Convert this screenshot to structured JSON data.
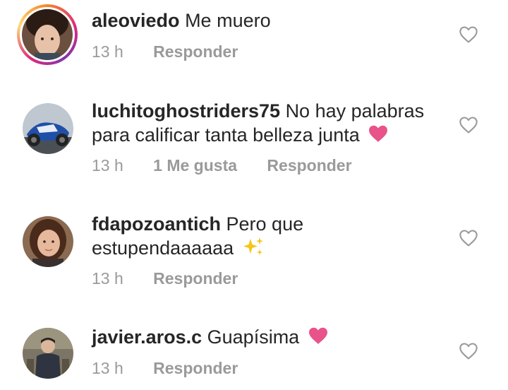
{
  "comments": [
    {
      "username": "aleoviedo",
      "text": "Me muero",
      "time": "13 h",
      "likes": "",
      "reply": "Responder",
      "has_story_ring": true,
      "emoji": ""
    },
    {
      "username": "luchitoghostriders75",
      "text": "No hay palabras para calificar tanta belleza junta",
      "time": "13 h",
      "likes": "1 Me gusta",
      "reply": "Responder",
      "has_story_ring": false,
      "emoji": "pink-heart"
    },
    {
      "username": "fdapozoantich",
      "text": "Pero que estupendaaaaaa",
      "time": "13 h",
      "likes": "",
      "reply": "Responder",
      "has_story_ring": false,
      "emoji": "sparkles"
    },
    {
      "username": "javier.aros.c",
      "text": "Guapísima",
      "time": "13 h",
      "likes": "",
      "reply": "Responder",
      "has_story_ring": false,
      "emoji": "pink-heart"
    }
  ],
  "icons": {
    "like": "heart-outline-icon",
    "heart_emoji_color": "#e8538a",
    "sparkles_color": "#f5c518"
  },
  "colors": {
    "text": "#262626",
    "meta": "#9a9a9a"
  }
}
